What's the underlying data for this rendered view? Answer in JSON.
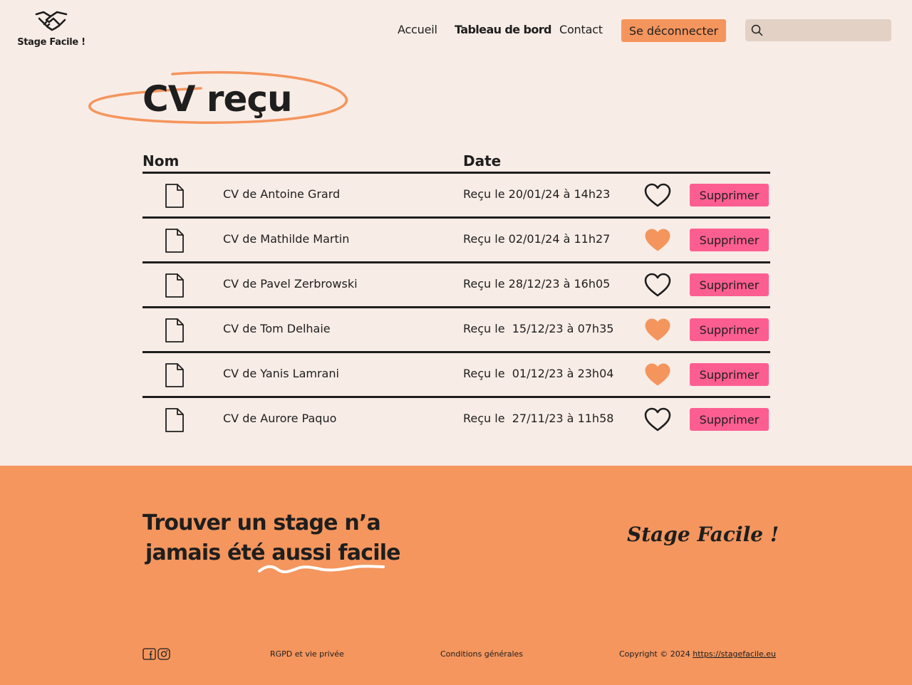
{
  "header": {
    "logo_text": "Stage Facile !",
    "nav": {
      "home": "Accueil",
      "dashboard": "Tableau de bord",
      "contact": "Contact"
    },
    "logout_label": "Se déconnecter",
    "search_placeholder": ""
  },
  "page": {
    "title": "CV reçu"
  },
  "table": {
    "headers": {
      "name": "Nom",
      "date": "Date"
    },
    "delete_label": "Supprimer",
    "rows": [
      {
        "name": "CV de Antoine Grard",
        "date": "Reçu le 20/01/24 à 14h23",
        "favorite": false
      },
      {
        "name": "CV de Mathilde Martin",
        "date": "Reçu le 02/01/24 à 11h27",
        "favorite": true
      },
      {
        "name": "CV de Pavel Zerbrowski",
        "date": "Reçu le 28/12/23 à 16h05",
        "favorite": false
      },
      {
        "name": "CV de Tom Delhaie",
        "date": "Reçu le  15/12/23 à 07h35",
        "favorite": true
      },
      {
        "name": "CV de Yanis Lamrani",
        "date": "Reçu le  01/12/23 à 23h04",
        "favorite": true
      },
      {
        "name": "CV de Aurore Paquo",
        "date": "Reçu le  27/11/23 à 11h58",
        "favorite": false
      }
    ]
  },
  "footer": {
    "tagline_line1": "Trouver un stage n’a",
    "tagline_line2": "jamais été aussi facile",
    "brand": "Stage Facile !",
    "rgpd": "RGPD et vie privée",
    "conditions": "Conditions générales",
    "copyright": "Copyright © 2024",
    "site_url": "https://stagefacile.eu"
  },
  "colors": {
    "background": "#f8ece6",
    "accent_orange": "#f4955d",
    "delete_pink": "#fc5e92",
    "search_bg": "#e3d1c5"
  }
}
